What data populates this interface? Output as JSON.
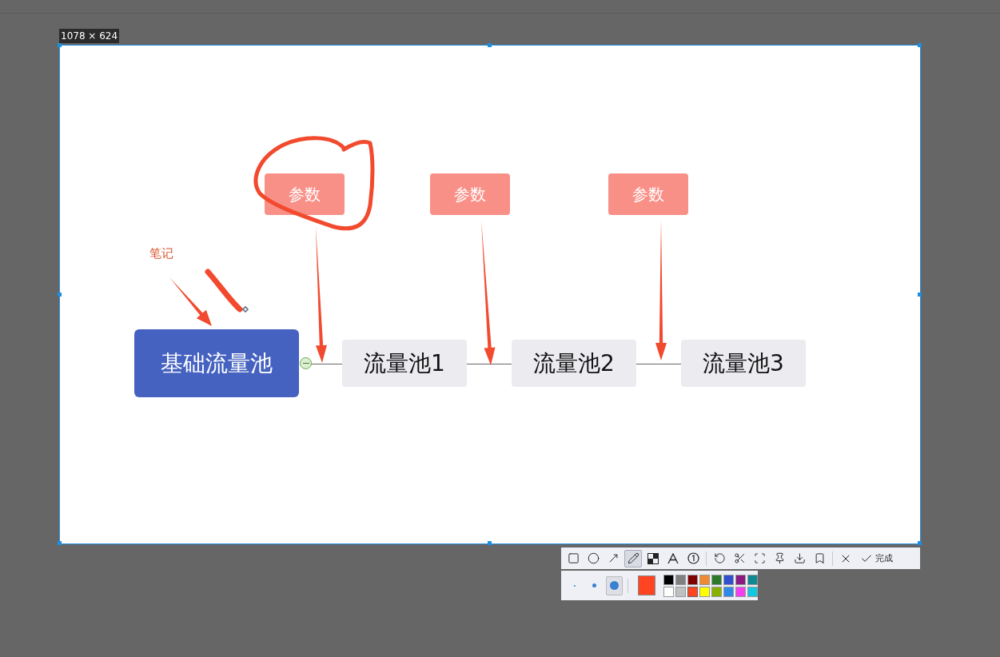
{
  "selection": {
    "size_label": "1078 × 624"
  },
  "diagram": {
    "root": "基础流量池",
    "note": "笔记",
    "nodes": [
      {
        "label": "流量池1",
        "param": "参数"
      },
      {
        "label": "流量池2",
        "param": "参数"
      },
      {
        "label": "流量池3",
        "param": "参数"
      }
    ]
  },
  "toolbar": {
    "tools": [
      {
        "kind": "rect",
        "selected": false
      },
      {
        "kind": "ellipse",
        "selected": false
      },
      {
        "kind": "arrow",
        "selected": false
      },
      {
        "kind": "pen",
        "selected": true
      },
      {
        "kind": "mosaic",
        "selected": false
      },
      {
        "kind": "text",
        "selected": false
      },
      {
        "kind": "number",
        "selected": false
      }
    ],
    "actions": [
      {
        "kind": "undo"
      },
      {
        "kind": "cut"
      },
      {
        "kind": "scan"
      },
      {
        "kind": "pin"
      },
      {
        "kind": "download"
      },
      {
        "kind": "bookmark"
      }
    ],
    "done": "完成"
  },
  "pen_sizes": [
    {
      "kind": "small",
      "selected": false
    },
    {
      "kind": "medium",
      "selected": false
    },
    {
      "kind": "large",
      "selected": true
    }
  ],
  "palette": [
    {
      "color": "#000000",
      "selected": false
    },
    {
      "color": "#808080",
      "selected": false
    },
    {
      "color": "#800000",
      "selected": false
    },
    {
      "color": "#f08a30",
      "selected": false
    },
    {
      "color": "#2a7a2a",
      "selected": false
    },
    {
      "color": "#3050d0",
      "selected": false
    },
    {
      "color": "#8a1a80",
      "selected": false
    },
    {
      "color": "#108890",
      "selected": false
    },
    {
      "color": "#ffffff",
      "selected": false
    },
    {
      "color": "#c0c0c0",
      "selected": false
    },
    {
      "color": "#ff4422",
      "selected": true
    },
    {
      "color": "#ffff00",
      "selected": false
    },
    {
      "color": "#88b000",
      "selected": false
    },
    {
      "color": "#3088e8",
      "selected": false
    },
    {
      "color": "#f040f0",
      "selected": false
    },
    {
      "color": "#10c8e0",
      "selected": false
    }
  ]
}
